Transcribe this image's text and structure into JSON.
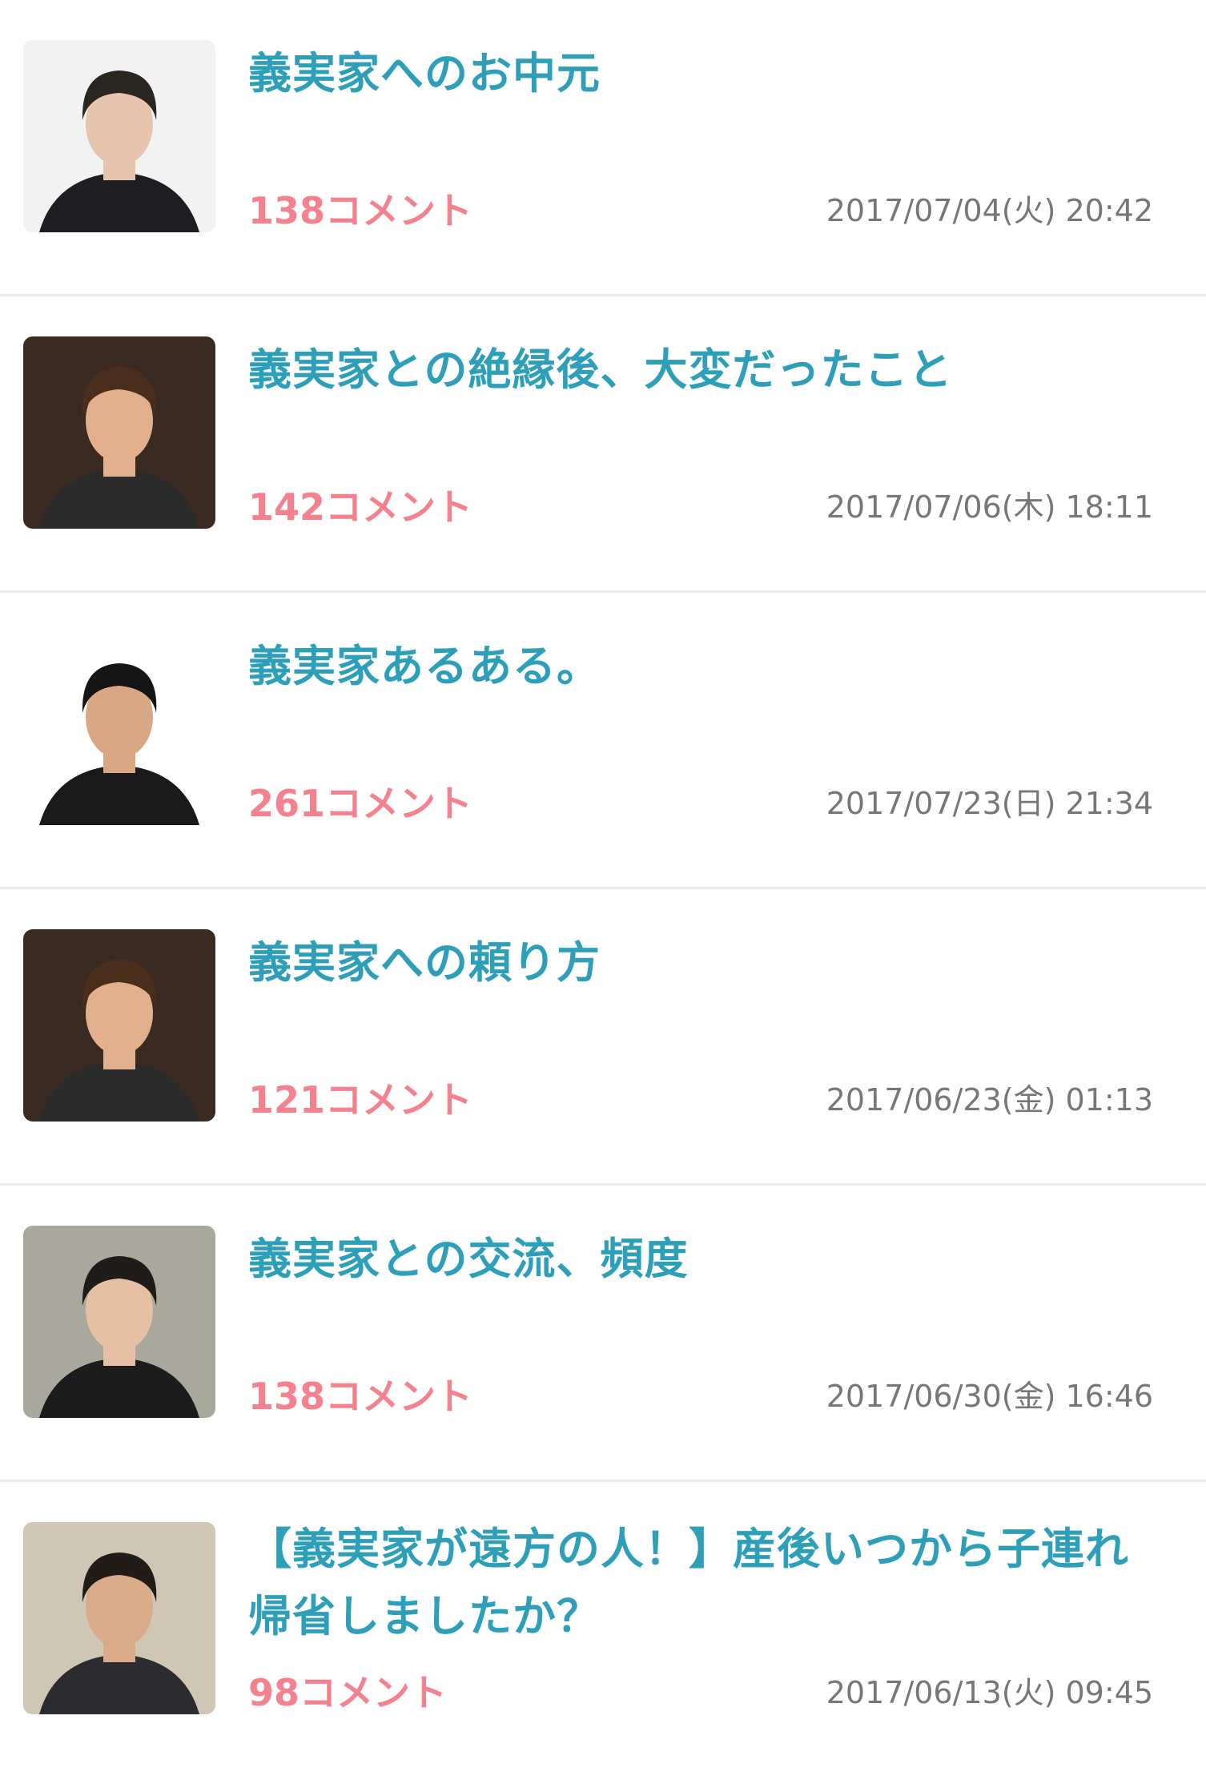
{
  "colors": {
    "title": "#2e9fb8",
    "comments": "#f5818e",
    "date": "#777777",
    "divider": "#ebebeb"
  },
  "items": [
    {
      "title": "義実家へのお中元",
      "comments": "138コメント",
      "date": "2017/07/04(火) 20:42",
      "thumbnail": "man-in-suit-photo",
      "thumb_bg": "#f2f2f2",
      "hair": "#2a2622",
      "skin": "#e7c4ad",
      "cloth": "#1e1e22"
    },
    {
      "title": "義実家との絶縁後、大変だったこと",
      "comments": "142コメント",
      "date": "2017/07/06(木) 18:11",
      "thumbnail": "smiling-man-photo",
      "thumb_bg": "#3a2a22",
      "hair": "#4a2e1c",
      "skin": "#e2b08c",
      "cloth": "#2b2b2b"
    },
    {
      "title": "義実家あるある。",
      "comments": "261コメント",
      "date": "2017/07/23(日) 21:34",
      "thumbnail": "man-in-jacket-photo",
      "thumb_bg": "#ffffff",
      "hair": "#151515",
      "skin": "#d9a784",
      "cloth": "#1a1a1a"
    },
    {
      "title": "義実家への頼り方",
      "comments": "121コメント",
      "date": "2017/06/23(金) 01:13",
      "thumbnail": "smiling-man-photo",
      "thumb_bg": "#3a2a22",
      "hair": "#4a2e1c",
      "skin": "#e2b08c",
      "cloth": "#2b2b2b"
    },
    {
      "title": "義実家との交流、頻度",
      "comments": "138コメント",
      "date": "2017/06/30(金) 16:46",
      "thumbnail": "man-outdoors-photo",
      "thumb_bg": "#a8a89c",
      "hair": "#1f1c1a",
      "skin": "#e6c0a4",
      "cloth": "#1c1c1c"
    },
    {
      "title": "【義実家が遠方の人！】産後いつから子連れ帰省しましたか？",
      "comments": "98コメント",
      "date": "2017/06/13(火) 09:45",
      "thumbnail": "man-portrait-photo",
      "thumb_bg": "#cfc6b4",
      "hair": "#221c18",
      "skin": "#d9ab88",
      "cloth": "#2c2c30"
    }
  ]
}
